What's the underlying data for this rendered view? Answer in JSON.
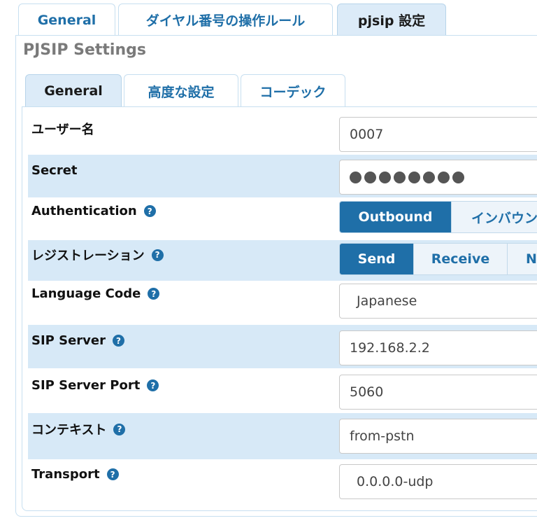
{
  "top_tabs": [
    {
      "label": "General"
    },
    {
      "label": "ダイヤル番号の操作ルール"
    },
    {
      "label": "pjsip 設定"
    }
  ],
  "panel_title": "PJSIP Settings",
  "inner_tabs": [
    {
      "label": "General"
    },
    {
      "label": "高度な設定"
    },
    {
      "label": "コーデック"
    }
  ],
  "help_glyph": "?",
  "form": {
    "username": {
      "label": "ユーザー名",
      "value": "0007"
    },
    "secret": {
      "label": "Secret",
      "masked_chars": 8
    },
    "authentication": {
      "label": "Authentication",
      "options": [
        "Outbound",
        "インバウン"
      ],
      "selected": "Outbound"
    },
    "registration": {
      "label": "レジストレーション",
      "options": [
        "Send",
        "Receive",
        "N"
      ],
      "selected": "Send"
    },
    "language_code": {
      "label": "Language Code",
      "value": "Japanese"
    },
    "sip_server": {
      "label": "SIP Server",
      "value": "192.168.2.2"
    },
    "sip_server_port": {
      "label": "SIP Server Port",
      "value": "5060"
    },
    "context": {
      "label": "コンテキスト",
      "value": "from-pstn"
    },
    "transport": {
      "label": "Transport",
      "value": "0.0.0.0-udp"
    }
  },
  "colors": {
    "accent": "#1f6fa8",
    "row_shade": "#d7e9f7",
    "active_tab": "#dcebf8"
  }
}
